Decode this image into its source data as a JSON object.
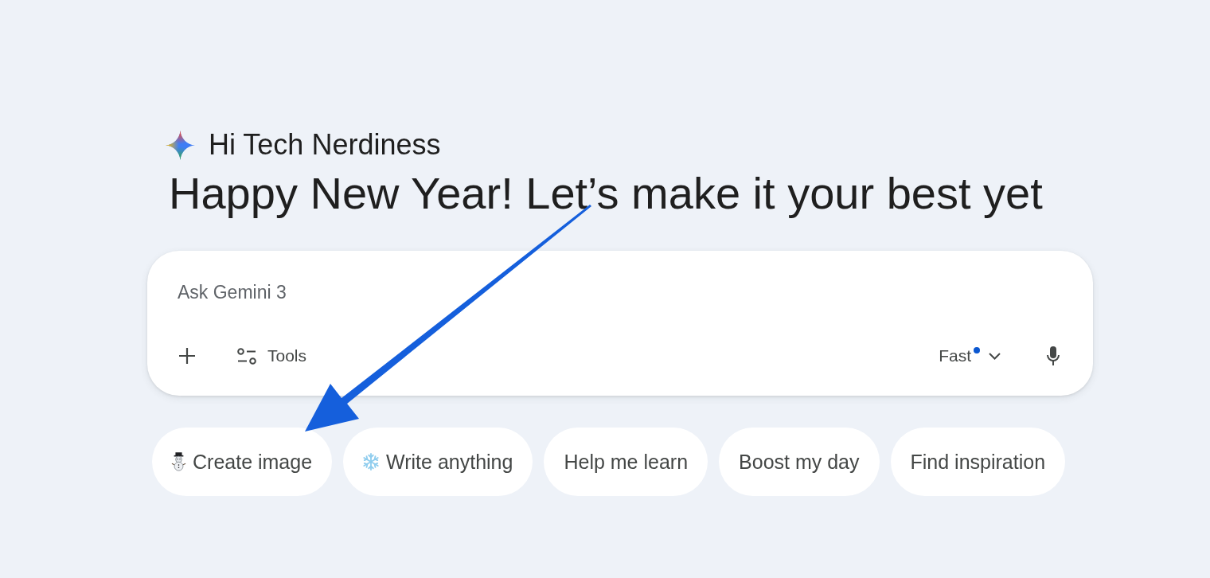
{
  "greeting": {
    "name": "Hi Tech Nerdiness",
    "headline": "Happy New Year! Let’s make it your best yet"
  },
  "prompt": {
    "placeholder": "Ask Gemini 3",
    "tools_label": "Tools",
    "model": {
      "label": "Fast",
      "dot": true
    }
  },
  "chips": [
    {
      "label": "Create image",
      "kind": "snowman"
    },
    {
      "label": "Write anything",
      "kind": "snowflake"
    },
    {
      "label": "Help me learn",
      "kind": "plain"
    },
    {
      "label": "Boost my day",
      "kind": "plain"
    },
    {
      "label": "Find inspiration",
      "kind": "plain"
    }
  ],
  "annotation": {
    "kind": "arrow"
  }
}
